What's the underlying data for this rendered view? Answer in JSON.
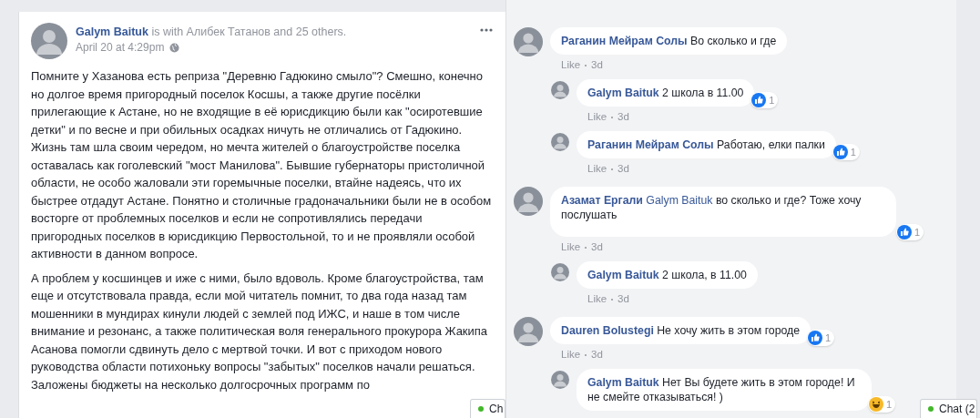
{
  "post": {
    "author": "Galym Baituk",
    "tagged": "is with Алибек Татанов and 25 others.",
    "date": "April 20 at 4:29pm",
    "paragraphs": [
      "Помните у Хазанова есть реприза \"Деревню Гадюкино смыло\"? Смешно, конечно но долгое время пригородный поселок Косшы, а также другие посёлки прилегающие к Астане, но не входящие в её юрисдикцию были как \"осиротевшие детки\" и по весне и при обильных осадках ничуть не отличались от Гадюкино. Жизнь там шла своим чередом, но мечта жителей о благоустройстве поселка оставалась как гоголевский \"мост Манилова\". Бывшие губернаторы пристоличной области, не особо жаловали эти горемычные поселки, втайне надеясь, что их быстрее отдадут Астане. Понятно и столичные градоначальники были не в особом восторге от проблемных поселков и если не сопротивлялись передачи пригородных поселков в юрисдикцию Первостольной, то и не проявляли особой активности в данном вопросе.",
      "А проблем у косшинцев и иже с ними, было вдоволь. Кроме благоустройства, там еще и отсутствовала правда, если мой читатель помнит, то два года назад там мошенники в мундирах кинули людей с землей под ИЖС, и наше в том числе внимание и резонанс, а также политическая воля генерального прокурора Жакипа Асанова помогли сдвинуть дело с мертвой точки. И вот с приходом нового руководства области потихоньку вопросы \"забытых\" поселков начали решаться. Заложены бюджеты на несколько долгосрочных программ по"
    ]
  },
  "comments": [
    {
      "author": "Раганин Мейрам Солы",
      "text": "Во сколько и где",
      "like": "Like",
      "time": "3d",
      "children": [
        {
          "author": "Galym Baituk",
          "text": "2 школа в 11.00",
          "like": "Like",
          "time": "3d",
          "reaction": {
            "kind": "like",
            "count": "1"
          }
        },
        {
          "author": "Раганин Мейрам Солы",
          "text": "Работаю, елки палки",
          "like": "Like",
          "time": "3d",
          "reaction": {
            "kind": "like",
            "count": "1"
          }
        }
      ]
    },
    {
      "author": "Азамат Ергали",
      "mention": "Galym Baituk",
      "text": "во сколько и где? Тоже хочу послушать",
      "like": "Like",
      "time": "3d",
      "reaction": {
        "kind": "like",
        "count": "1"
      },
      "children": [
        {
          "author": "Galym Baituk",
          "text": "2 школа, в 11.00",
          "like": "Like",
          "time": "3d"
        }
      ]
    },
    {
      "author": "Dauren Bolustegi",
      "text": "Не хочу жить в этом городе",
      "like": "Like",
      "time": "3d",
      "reaction": {
        "kind": "like",
        "count": "1"
      },
      "children": [
        {
          "author": "Galym Baituk",
          "text": "Нет Вы будете жить в этом городе! И не смейте отказываться! )",
          "reaction": {
            "kind": "haha",
            "count": "1"
          }
        }
      ]
    }
  ],
  "chat_tabs": [
    {
      "label": "Ch",
      "color": "#42b72a"
    },
    {
      "label": "Chat (2",
      "color": "#42b72a"
    }
  ]
}
